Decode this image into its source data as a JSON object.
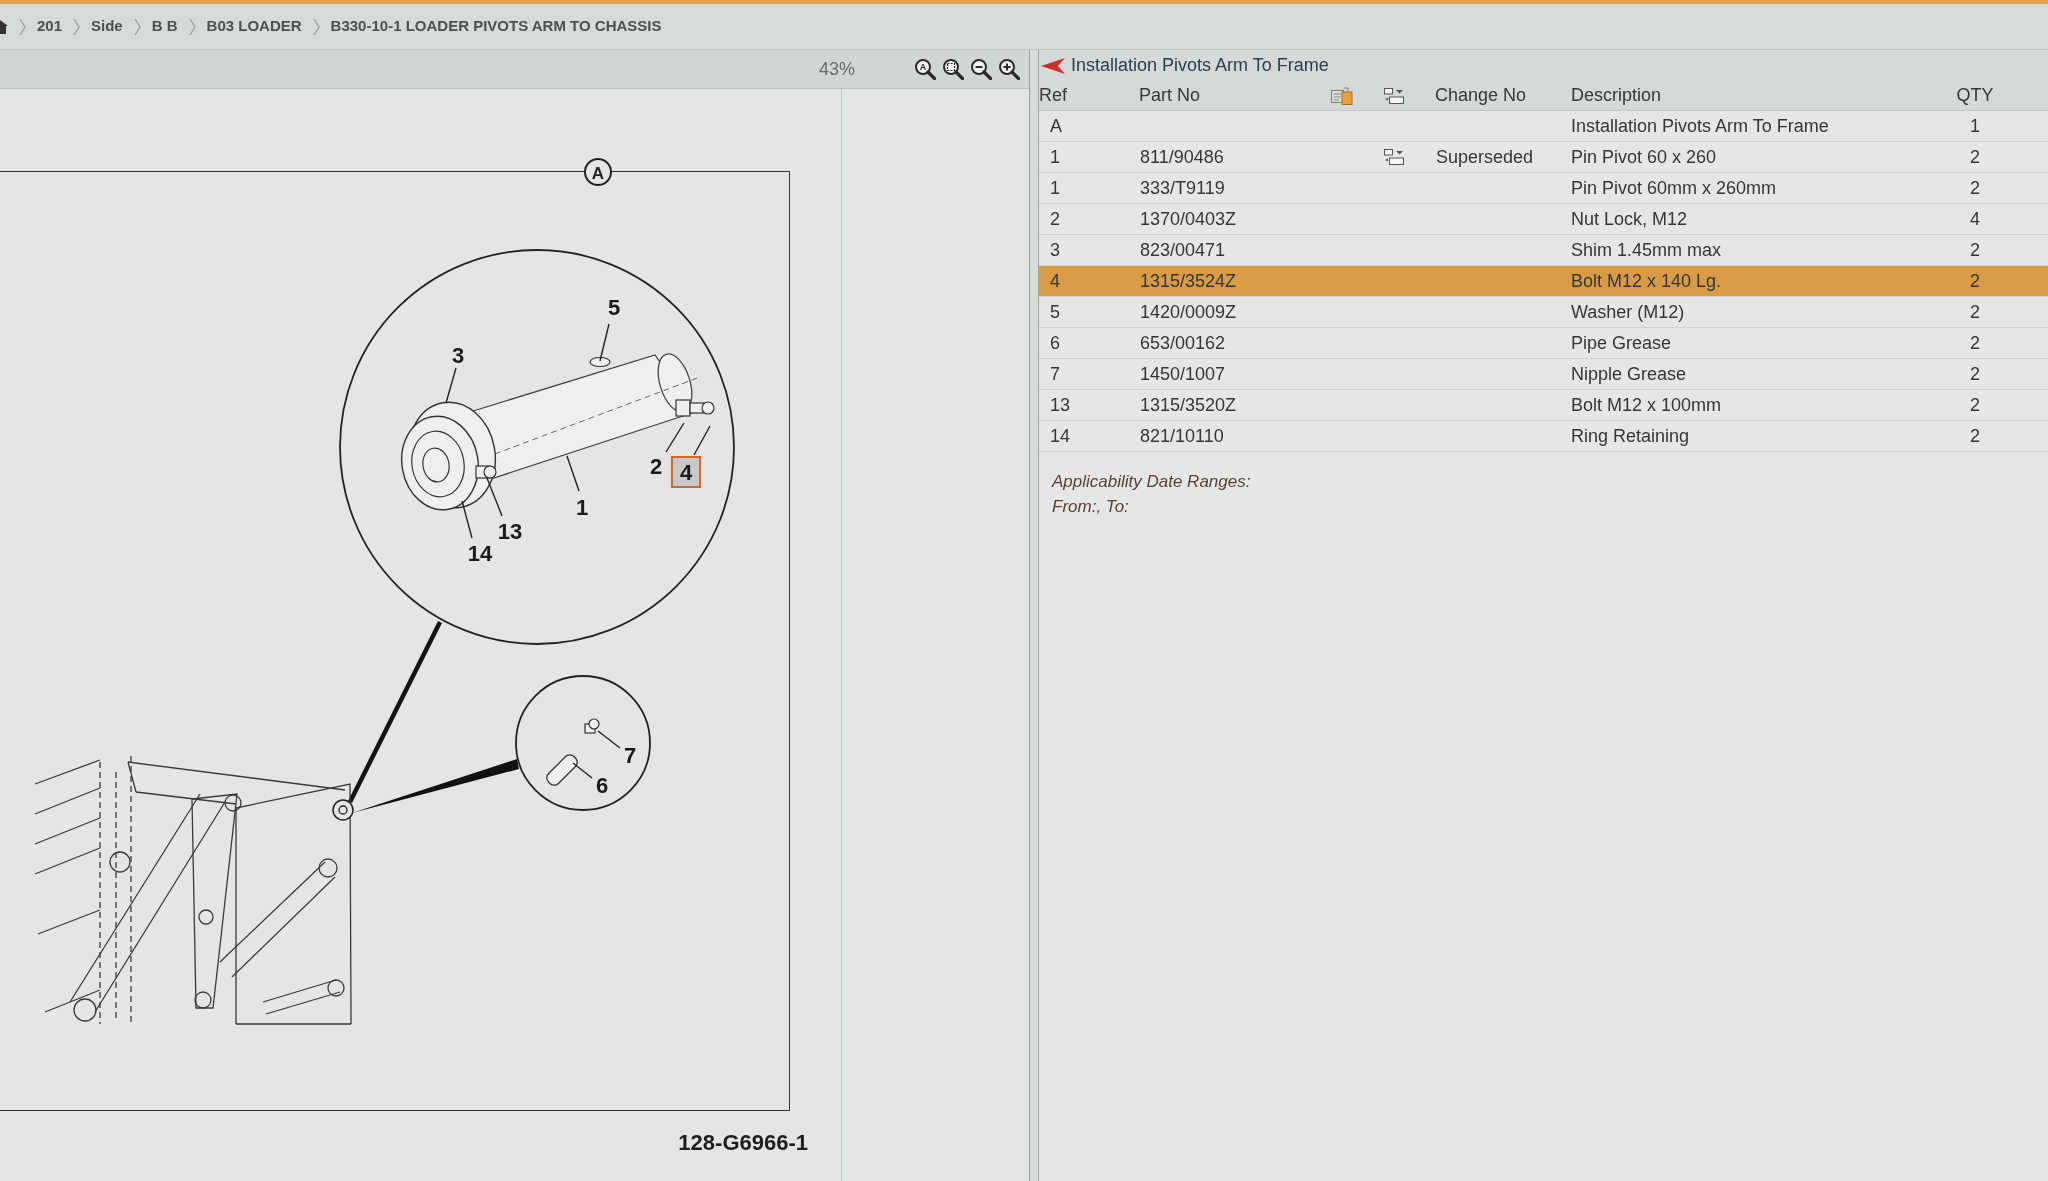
{
  "breadcrumb": {
    "items": [
      "201",
      "Side",
      "B B",
      "B03 LOADER",
      "B330-10-1 LOADER PIVOTS ARM TO CHASSIS"
    ]
  },
  "drawing_toolbar": {
    "zoom_reading": "43%",
    "zoom_buttons": [
      {
        "kind": "letter",
        "glyph": "A"
      },
      {
        "kind": "fit"
      },
      {
        "kind": "out"
      },
      {
        "kind": "in"
      }
    ]
  },
  "drawing": {
    "view_label": "A",
    "callouts": [
      {
        "label": "5",
        "selected": false
      },
      {
        "label": "3",
        "selected": false
      },
      {
        "label": "2",
        "selected": false
      },
      {
        "label": "4",
        "selected": true
      },
      {
        "label": "1",
        "selected": false
      },
      {
        "label": "13",
        "selected": false
      },
      {
        "label": "14",
        "selected": false
      },
      {
        "label": "7",
        "selected": false
      },
      {
        "label": "6",
        "selected": false
      }
    ],
    "drawing_number": "128-G6966-1"
  },
  "parts_list": {
    "title": "Installation Pivots Arm To Frame",
    "columns": [
      "Ref",
      "Part No",
      "Change No",
      "Description",
      "QTY"
    ],
    "rows": [
      {
        "ref": "A",
        "description": "Installation Pivots Arm To Frame",
        "qty": "1",
        "change_icon": false,
        "selected": false
      },
      {
        "ref": "1",
        "part_no": "811/90486",
        "change_no": "Superseded",
        "description": "Pin Pivot 60 x 260",
        "qty": "2",
        "change_icon": true,
        "selected": false
      },
      {
        "ref": "1",
        "part_no": "333/T9119",
        "description": "Pin Pivot 60mm x 260mm",
        "qty": "2",
        "change_icon": false,
        "selected": false
      },
      {
        "ref": "2",
        "part_no": "1370/0403Z",
        "description": "Nut Lock, M12",
        "qty": "4",
        "change_icon": false,
        "selected": false
      },
      {
        "ref": "3",
        "part_no": "823/00471",
        "description": "Shim 1.45mm max",
        "qty": "2",
        "change_icon": false,
        "selected": false
      },
      {
        "ref": "4",
        "part_no": "1315/3524Z",
        "description": "Bolt M12 x 140 Lg.",
        "qty": "2",
        "change_icon": false,
        "selected": true
      },
      {
        "ref": "5",
        "part_no": "1420/0009Z",
        "description": "Washer (M12)",
        "qty": "2",
        "change_icon": false,
        "selected": false
      },
      {
        "ref": "6",
        "part_no": "653/00162",
        "description": "Pipe Grease",
        "qty": "2",
        "change_icon": false,
        "selected": false
      },
      {
        "ref": "7",
        "part_no": "1450/1007",
        "description": "Nipple Grease",
        "qty": "2",
        "change_icon": false,
        "selected": false
      },
      {
        "ref": "13",
        "part_no": "1315/3520Z",
        "description": "Bolt M12 x 100mm",
        "qty": "2",
        "change_icon": false,
        "selected": false
      },
      {
        "ref": "14",
        "part_no": "821/10110",
        "description": "Ring Retaining",
        "qty": "2",
        "change_icon": false,
        "selected": false
      }
    ],
    "applicability": {
      "heading": "Applicability Date Ranges:",
      "range": "From:, To:"
    }
  }
}
